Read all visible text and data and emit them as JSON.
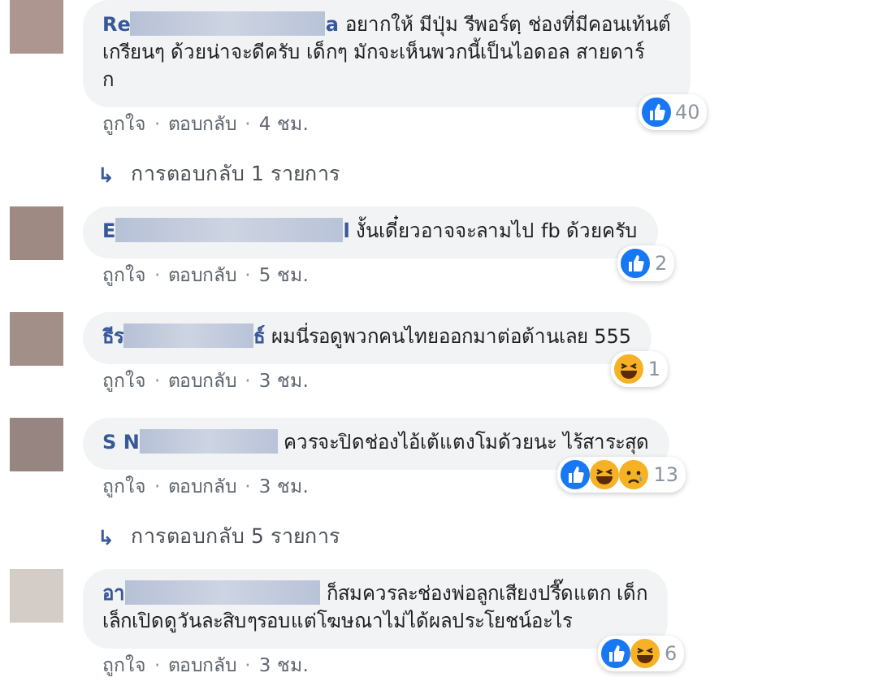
{
  "thread": [
    {
      "kind": "comment",
      "color": "#ad968f",
      "name_start": "Re",
      "name_end": "a",
      "lines": [
        "อยากให้ มีปุ่ม รีพอร์ตฺ ช่องที่มีคอนเท้นต์",
        "เกรียนๆ ด้วยน่าจะดีครับ เด็กๆ มักจะเห็นพวกนี้เป็นไอดอล สายดาร์",
        "ก"
      ],
      "reactions": [
        {
          "kind": "like"
        }
      ],
      "count": "40",
      "separator": "·",
      "actions": [
        "ถูกใจ",
        "ตอบกลับ",
        "4 ชม."
      ]
    },
    {
      "kind": "replies",
      "icon": "↳",
      "label": "การตอบกลับ 1 รายการ"
    },
    {
      "kind": "comment",
      "color": "#9e8a82",
      "name_start": "E",
      "name_end": "l",
      "lines": [
        "งั้นเดี๋ยวอาจจะลามไป fb ด้วยครับ"
      ],
      "reactions": [
        {
          "kind": "like"
        }
      ],
      "count": "2",
      "separator": "·",
      "actions": [
        "ถูกใจ",
        "ตอบกลับ",
        "5 ชม."
      ]
    },
    {
      "kind": "comment",
      "color": "#a29088",
      "name_start": "ธีร",
      "name_end": "ธ์",
      "lines": [
        "ผมนี่รอดูพวกคนไทยออกมาต่อต้านเลย 555"
      ],
      "reactions": [
        {
          "kind": "haha"
        }
      ],
      "count": "1",
      "separator": "·",
      "actions": [
        "ถูกใจ",
        "ตอบกลับ",
        "3 ชม."
      ]
    },
    {
      "kind": "comment",
      "color": "#968580",
      "name_start": "S N",
      "lines": [
        "ควรจะปิดช่องไอ้เต้แตงโมด้วยนะ ไร้สาระสุด"
      ],
      "reactions": [
        {
          "kind": "like"
        },
        {
          "kind": "haha"
        },
        {
          "kind": "sad"
        }
      ],
      "count": "13",
      "separator": "·",
      "actions": [
        "ถูกใจ",
        "ตอบกลับ",
        "3 ชม."
      ]
    },
    {
      "kind": "replies",
      "icon": "↳",
      "label": "การตอบกลับ 5 รายการ"
    },
    {
      "kind": "comment",
      "color": "#d4ccc7",
      "name_start": "อา",
      "lines": [
        "ก็สมควรละช่องพ่อลูกเสียงปรี๊ดแตก เด็ก",
        "เล็กเปิดดูวันละสิบๆรอบแต่โฆษณาไม่ได้ผลประโยชน์อะไร"
      ],
      "reactions": [
        {
          "kind": "like"
        },
        {
          "kind": "haha"
        }
      ],
      "count": "6",
      "separator": "·",
      "actions": [
        "ถูกใจ",
        "ตอบกลับ",
        "3 ชม."
      ]
    }
  ]
}
